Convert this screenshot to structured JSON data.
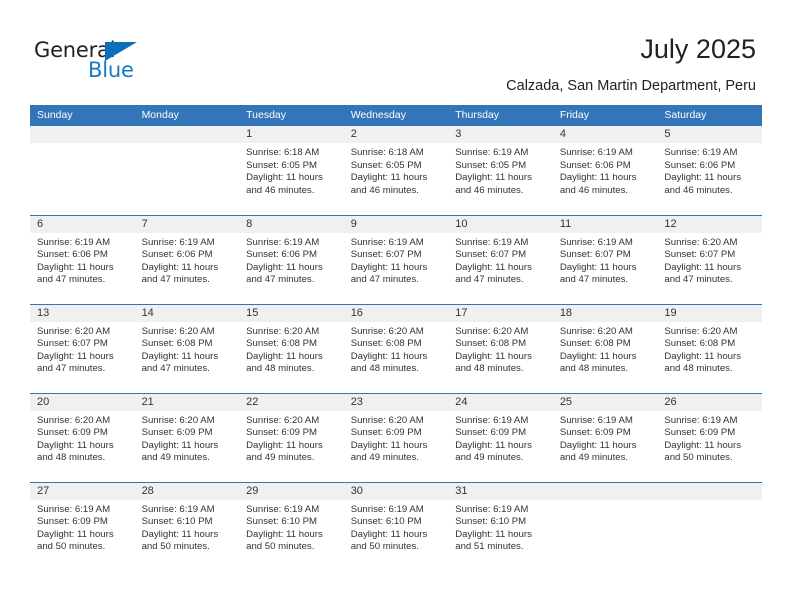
{
  "logo": {
    "word_top": "General",
    "word_bottom": "Blue",
    "triangle_color": "#0e6eb8",
    "blue_text_color": "#1b7ac4"
  },
  "header": {
    "title": "July 2025",
    "subtitle": "Calzada, San Martin Department, Peru"
  },
  "theme": {
    "header_blue": "#3375b8",
    "daynum_band": "#f0f0f0",
    "text": "#333333"
  },
  "calendar": {
    "weekdays": [
      "Sunday",
      "Monday",
      "Tuesday",
      "Wednesday",
      "Thursday",
      "Friday",
      "Saturday"
    ],
    "weeks": [
      [
        {
          "day": "",
          "lines": []
        },
        {
          "day": "",
          "lines": []
        },
        {
          "day": "1",
          "lines": [
            "Sunrise: 6:18 AM",
            "Sunset: 6:05 PM",
            "Daylight: 11 hours",
            "and 46 minutes."
          ]
        },
        {
          "day": "2",
          "lines": [
            "Sunrise: 6:18 AM",
            "Sunset: 6:05 PM",
            "Daylight: 11 hours",
            "and 46 minutes."
          ]
        },
        {
          "day": "3",
          "lines": [
            "Sunrise: 6:19 AM",
            "Sunset: 6:05 PM",
            "Daylight: 11 hours",
            "and 46 minutes."
          ]
        },
        {
          "day": "4",
          "lines": [
            "Sunrise: 6:19 AM",
            "Sunset: 6:06 PM",
            "Daylight: 11 hours",
            "and 46 minutes."
          ]
        },
        {
          "day": "5",
          "lines": [
            "Sunrise: 6:19 AM",
            "Sunset: 6:06 PM",
            "Daylight: 11 hours",
            "and 46 minutes."
          ]
        }
      ],
      [
        {
          "day": "6",
          "lines": [
            "Sunrise: 6:19 AM",
            "Sunset: 6:06 PM",
            "Daylight: 11 hours",
            "and 47 minutes."
          ]
        },
        {
          "day": "7",
          "lines": [
            "Sunrise: 6:19 AM",
            "Sunset: 6:06 PM",
            "Daylight: 11 hours",
            "and 47 minutes."
          ]
        },
        {
          "day": "8",
          "lines": [
            "Sunrise: 6:19 AM",
            "Sunset: 6:06 PM",
            "Daylight: 11 hours",
            "and 47 minutes."
          ]
        },
        {
          "day": "9",
          "lines": [
            "Sunrise: 6:19 AM",
            "Sunset: 6:07 PM",
            "Daylight: 11 hours",
            "and 47 minutes."
          ]
        },
        {
          "day": "10",
          "lines": [
            "Sunrise: 6:19 AM",
            "Sunset: 6:07 PM",
            "Daylight: 11 hours",
            "and 47 minutes."
          ]
        },
        {
          "day": "11",
          "lines": [
            "Sunrise: 6:19 AM",
            "Sunset: 6:07 PM",
            "Daylight: 11 hours",
            "and 47 minutes."
          ]
        },
        {
          "day": "12",
          "lines": [
            "Sunrise: 6:20 AM",
            "Sunset: 6:07 PM",
            "Daylight: 11 hours",
            "and 47 minutes."
          ]
        }
      ],
      [
        {
          "day": "13",
          "lines": [
            "Sunrise: 6:20 AM",
            "Sunset: 6:07 PM",
            "Daylight: 11 hours",
            "and 47 minutes."
          ]
        },
        {
          "day": "14",
          "lines": [
            "Sunrise: 6:20 AM",
            "Sunset: 6:08 PM",
            "Daylight: 11 hours",
            "and 47 minutes."
          ]
        },
        {
          "day": "15",
          "lines": [
            "Sunrise: 6:20 AM",
            "Sunset: 6:08 PM",
            "Daylight: 11 hours",
            "and 48 minutes."
          ]
        },
        {
          "day": "16",
          "lines": [
            "Sunrise: 6:20 AM",
            "Sunset: 6:08 PM",
            "Daylight: 11 hours",
            "and 48 minutes."
          ]
        },
        {
          "day": "17",
          "lines": [
            "Sunrise: 6:20 AM",
            "Sunset: 6:08 PM",
            "Daylight: 11 hours",
            "and 48 minutes."
          ]
        },
        {
          "day": "18",
          "lines": [
            "Sunrise: 6:20 AM",
            "Sunset: 6:08 PM",
            "Daylight: 11 hours",
            "and 48 minutes."
          ]
        },
        {
          "day": "19",
          "lines": [
            "Sunrise: 6:20 AM",
            "Sunset: 6:08 PM",
            "Daylight: 11 hours",
            "and 48 minutes."
          ]
        }
      ],
      [
        {
          "day": "20",
          "lines": [
            "Sunrise: 6:20 AM",
            "Sunset: 6:09 PM",
            "Daylight: 11 hours",
            "and 48 minutes."
          ]
        },
        {
          "day": "21",
          "lines": [
            "Sunrise: 6:20 AM",
            "Sunset: 6:09 PM",
            "Daylight: 11 hours",
            "and 49 minutes."
          ]
        },
        {
          "day": "22",
          "lines": [
            "Sunrise: 6:20 AM",
            "Sunset: 6:09 PM",
            "Daylight: 11 hours",
            "and 49 minutes."
          ]
        },
        {
          "day": "23",
          "lines": [
            "Sunrise: 6:20 AM",
            "Sunset: 6:09 PM",
            "Daylight: 11 hours",
            "and 49 minutes."
          ]
        },
        {
          "day": "24",
          "lines": [
            "Sunrise: 6:19 AM",
            "Sunset: 6:09 PM",
            "Daylight: 11 hours",
            "and 49 minutes."
          ]
        },
        {
          "day": "25",
          "lines": [
            "Sunrise: 6:19 AM",
            "Sunset: 6:09 PM",
            "Daylight: 11 hours",
            "and 49 minutes."
          ]
        },
        {
          "day": "26",
          "lines": [
            "Sunrise: 6:19 AM",
            "Sunset: 6:09 PM",
            "Daylight: 11 hours",
            "and 50 minutes."
          ]
        }
      ],
      [
        {
          "day": "27",
          "lines": [
            "Sunrise: 6:19 AM",
            "Sunset: 6:09 PM",
            "Daylight: 11 hours",
            "and 50 minutes."
          ]
        },
        {
          "day": "28",
          "lines": [
            "Sunrise: 6:19 AM",
            "Sunset: 6:10 PM",
            "Daylight: 11 hours",
            "and 50 minutes."
          ]
        },
        {
          "day": "29",
          "lines": [
            "Sunrise: 6:19 AM",
            "Sunset: 6:10 PM",
            "Daylight: 11 hours",
            "and 50 minutes."
          ]
        },
        {
          "day": "30",
          "lines": [
            "Sunrise: 6:19 AM",
            "Sunset: 6:10 PM",
            "Daylight: 11 hours",
            "and 50 minutes."
          ]
        },
        {
          "day": "31",
          "lines": [
            "Sunrise: 6:19 AM",
            "Sunset: 6:10 PM",
            "Daylight: 11 hours",
            "and 51 minutes."
          ]
        },
        {
          "day": "",
          "lines": []
        },
        {
          "day": "",
          "lines": []
        }
      ]
    ]
  }
}
